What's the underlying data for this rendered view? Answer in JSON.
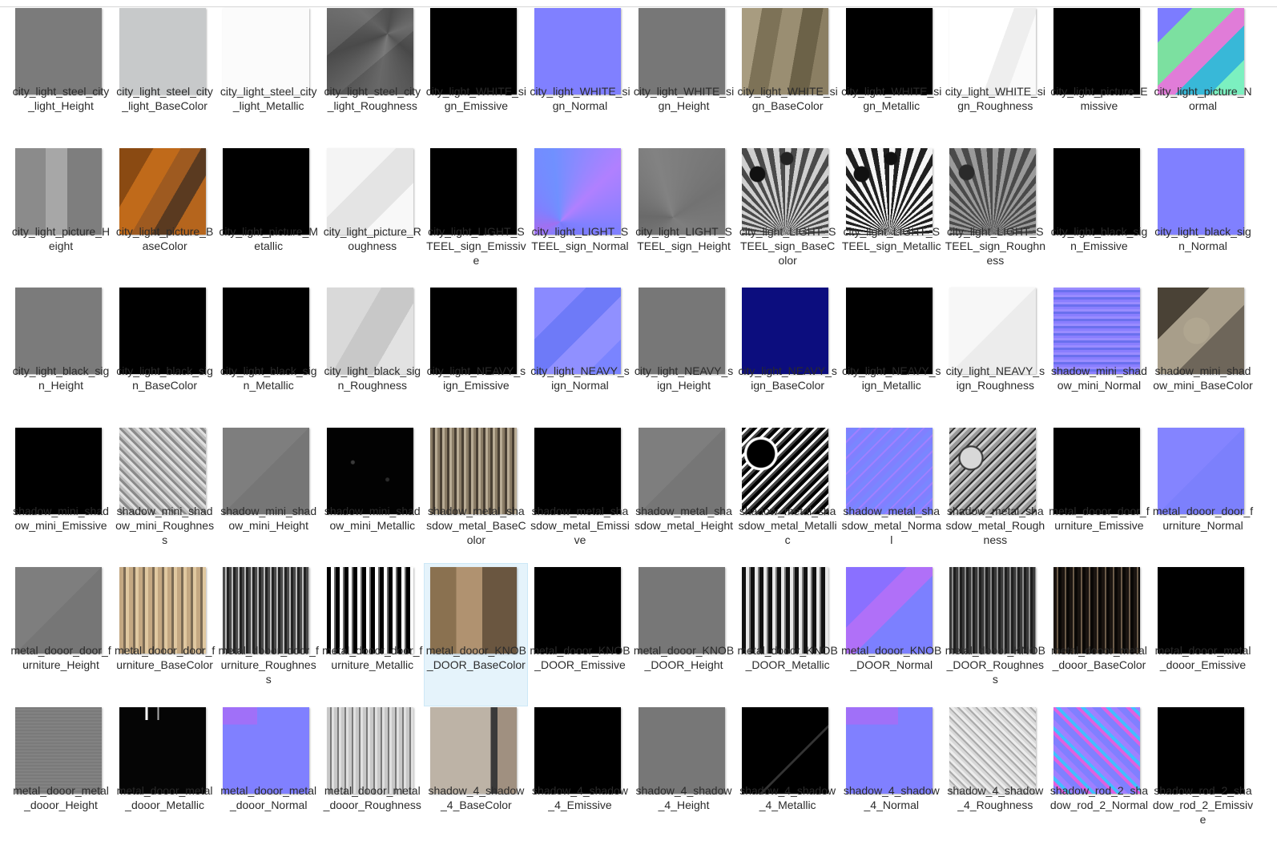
{
  "files": [
    {
      "label": "city_light_steel_city_light_Height",
      "thumb": "t-grey"
    },
    {
      "label": "city_light_steel_city_light_BaseColor",
      "thumb": "t-lightgrey"
    },
    {
      "label": "city_light_steel_city_light_Metallic",
      "thumb": "t-white"
    },
    {
      "label": "city_light_steel_city_light_Roughness",
      "thumb": "t-darkgrey-rays"
    },
    {
      "label": "city_light_WHITE_sign_Emissive",
      "thumb": "t-black"
    },
    {
      "label": "city_light_WHITE_sign_Normal",
      "thumb": "t-blue"
    },
    {
      "label": "city_light_WHITE_sign_Height",
      "thumb": "t-grey2"
    },
    {
      "label": "city_light_WHITE_sign_BaseColor",
      "thumb": "t-tan"
    },
    {
      "label": "city_light_WHITE_sign_Metallic",
      "thumb": "t-black"
    },
    {
      "label": "city_light_WHITE_sign_Roughness",
      "thumb": "t-greyish-white"
    },
    {
      "label": "city_light_picture_Emissive",
      "thumb": "t-black"
    },
    {
      "label": "city_light_picture_Normal",
      "thumb": "t-colorful"
    },
    {
      "label": "city_light_picture_Height",
      "thumb": "t-grey-blocks"
    },
    {
      "label": "city_light_picture_BaseColor",
      "thumb": "t-orange"
    },
    {
      "label": "city_light_picture_Metallic",
      "thumb": "t-black"
    },
    {
      "label": "city_light_picture_Roughness",
      "thumb": "t-verylight"
    },
    {
      "label": "city_light_LIGHT_STEEL_sign_Emissive",
      "thumb": "t-black"
    },
    {
      "label": "city_light_LIGHT_STEEL_sign_Normal",
      "thumb": "t-blue-rays"
    },
    {
      "label": "city_light_LIGHT_STEEL_sign_Height",
      "thumb": "t-grey-dark-rays"
    },
    {
      "label": "city_light_LIGHT_STEEL_sign_BaseColor",
      "thumb": "t-bw-rays"
    },
    {
      "label": "city_light_LIGHT_STEEL_sign_Metallic",
      "thumb": "t-bw-rays2"
    },
    {
      "label": "city_light_LIGHT_STEEL_sign_Roughness",
      "thumb": "t-grey-rays3"
    },
    {
      "label": "city_light_black_sign_Emissive",
      "thumb": "t-black"
    },
    {
      "label": "city_light_black_sign_Normal",
      "thumb": "t-blue"
    },
    {
      "label": "city_light_black_sign_Height",
      "thumb": "t-grey"
    },
    {
      "label": "city_light_black_sign_BaseColor",
      "thumb": "t-black"
    },
    {
      "label": "city_light_black_sign_Metallic",
      "thumb": "t-black"
    },
    {
      "label": "city_light_black_sign_Roughness",
      "thumb": "t-light-blocks"
    },
    {
      "label": "city_light_NEAVY_sign_Emissive",
      "thumb": "t-black"
    },
    {
      "label": "city_light_NEAVY_sign_Normal",
      "thumb": "t-blue-mixed"
    },
    {
      "label": "city_light_NEAVY_sign_Height",
      "thumb": "t-grey2"
    },
    {
      "label": "city_light_NEAVY_sign_BaseColor",
      "thumb": "t-navy"
    },
    {
      "label": "city_light_NEAVY_sign_Metallic",
      "thumb": "t-black"
    },
    {
      "label": "city_light_NEAVY_sign_Roughness",
      "thumb": "t-white-soft"
    },
    {
      "label": "shadow_mini_shadow_mini_Normal",
      "thumb": "t-blue-noise"
    },
    {
      "label": "shadow_mini_shadow_mini_BaseColor",
      "thumb": "t-brown-grey"
    },
    {
      "label": "shadow_mini_shadow_mini_Emissive",
      "thumb": "t-black"
    },
    {
      "label": "shadow_mini_shadow_mini_Roughness",
      "thumb": "t-grey-noise"
    },
    {
      "label": "shadow_mini_shadow_mini_Height",
      "thumb": "t-grey-flat"
    },
    {
      "label": "shadow_mini_shadow_mini_Metallic",
      "thumb": "t-black-spots"
    },
    {
      "label": "shadow_metal_shasdow_metal_BaseColor",
      "thumb": "t-brown-noise"
    },
    {
      "label": "shadow_metal_shasdow_metal_Emissive",
      "thumb": "t-black"
    },
    {
      "label": "shadow_metal_shasdow_metal_Height",
      "thumb": "t-grey-flat"
    },
    {
      "label": "shadow_metal_shasdow_metal_Metallic",
      "thumb": "t-bw-mix"
    },
    {
      "label": "shadow_metal_shasdow_metal_Normal",
      "thumb": "t-blue-lines"
    },
    {
      "label": "shadow_metal_shasdow_metal_Roughness",
      "thumb": "t-grey-circle"
    },
    {
      "label": "metal_dooor_door_furniture_Emissive",
      "thumb": "t-black"
    },
    {
      "label": "metal_dooor_door_furniture_Normal",
      "thumb": "t-blue-flat2"
    },
    {
      "label": "metal_dooor_door_furniture_Height",
      "thumb": "t-grey-flat"
    },
    {
      "label": "metal_dooor_door_furniture_BaseColor",
      "thumb": "t-tan-stripes"
    },
    {
      "label": "metal_dooor_door_furniture_Roughness",
      "thumb": "t-dark-stripes"
    },
    {
      "label": "metal_dooor_door_furniture_Metallic",
      "thumb": "t-bw-stripes"
    },
    {
      "label": "metal_dooor_KNOB_DOOR_BaseColor",
      "thumb": "t-tan2",
      "selected": true
    },
    {
      "label": "metal_dooor_KNOB_DOOR_Emissive",
      "thumb": "t-black"
    },
    {
      "label": "metal_dooor_KNOB_DOOR_Height",
      "thumb": "t-grey2"
    },
    {
      "label": "metal_dooor_KNOB_DOOR_Metallic",
      "thumb": "t-bw-stripes2"
    },
    {
      "label": "metal_dooor_KNOB_DOOR_Normal",
      "thumb": "t-blue-grad"
    },
    {
      "label": "metal_dooor_KNOB_DOOR_Roughness",
      "thumb": "t-dark-noise"
    },
    {
      "label": "metal_dooor_metal_dooor_BaseColor",
      "thumb": "t-brown-dark"
    },
    {
      "label": "metal_dooor_metal_dooor_Emissive",
      "thumb": "t-black"
    },
    {
      "label": "metal_dooor_metal_dooor_Height",
      "thumb": "t-grey-noise2"
    },
    {
      "label": "metal_dooor_metal_dooor_Metallic",
      "thumb": "t-black-bars"
    },
    {
      "label": "metal_dooor_metal_dooor_Normal",
      "thumb": "t-blue-bars"
    },
    {
      "label": "metal_dooor_metal_dooor_Roughness",
      "thumb": "t-grey-texture"
    },
    {
      "label": "shadow_4_shadow_4_BaseColor",
      "thumb": "t-grey-tan"
    },
    {
      "label": "shadow_4_shadow_4_Emissive",
      "thumb": "t-black"
    },
    {
      "label": "shadow_4_shadow_4_Height",
      "thumb": "t-grey2"
    },
    {
      "label": "shadow_4_shadow_4_Metallic",
      "thumb": "t-black-shape"
    },
    {
      "label": "shadow_4_shadow_4_Normal",
      "thumb": "t-blue-bars2"
    },
    {
      "label": "shadow_4_shadow_4_Roughness",
      "thumb": "t-grey-light-noise"
    },
    {
      "label": "shadow_rod_2_shadow_rod_2_Normal",
      "thumb": "t-rainbow"
    },
    {
      "label": "shadow_rod_2_shadow_rod_2_Emissive",
      "thumb": "t-black"
    }
  ]
}
